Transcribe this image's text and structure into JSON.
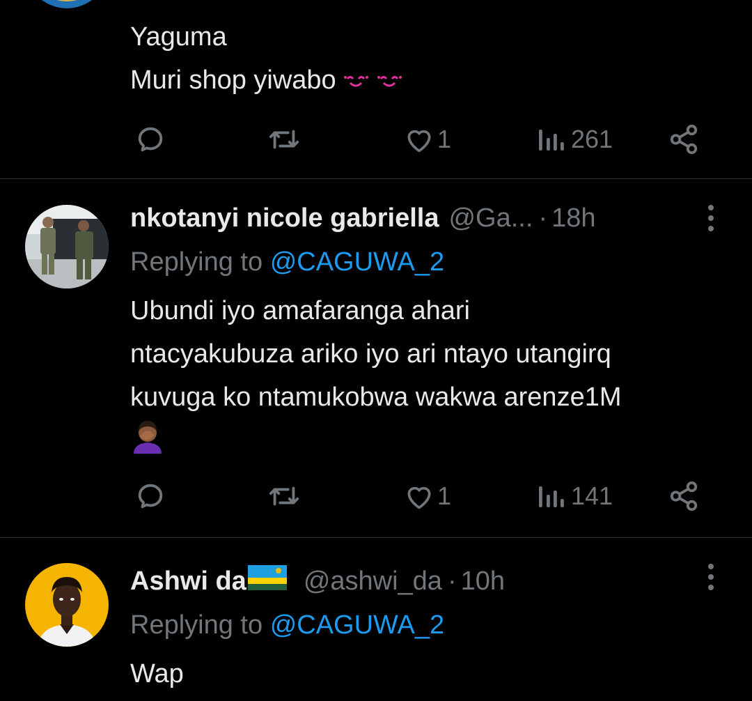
{
  "colors": {
    "background": "#000000",
    "text_primary": "#e7e9ea",
    "text_secondary": "#71767b",
    "link": "#1d9bf0",
    "divider": "#2f3336"
  },
  "tweets": [
    {
      "lines": [
        "Yaguma",
        "Muri shop yiwabo"
      ],
      "emoji": "smiling-face-emoji",
      "replies_icon": "reply-icon",
      "retweet_icon": "retweet-icon",
      "likes": "1",
      "views": "261",
      "share_icon": "share-icon"
    },
    {
      "avatar_icon": "soldiers-photo-avatar",
      "name": "nkotanyi nicole gabriella",
      "handle": "@Ga...",
      "dot": "·",
      "time": "18h",
      "replying_prefix": "Replying to",
      "replying_to": "@CAGUWA_2",
      "lines": [
        "Ubundi iyo amafaranga ahari",
        "ntacyakubuza ariko iyo ari ntayo utangirq",
        "kuvuga ko ntamukobwa wakwa arenze1M"
      ],
      "emoji": "facepalm-emoji",
      "likes": "1",
      "views": "141"
    },
    {
      "avatar_icon": "person-photo-avatar",
      "name": "Ashwi da",
      "flag": "rwanda-flag-emoji",
      "handle": "@ashwi_da",
      "dot": "·",
      "time": "10h",
      "replying_prefix": "Replying to",
      "replying_to": "@CAGUWA_2",
      "lines": [
        "Wap"
      ]
    }
  ]
}
